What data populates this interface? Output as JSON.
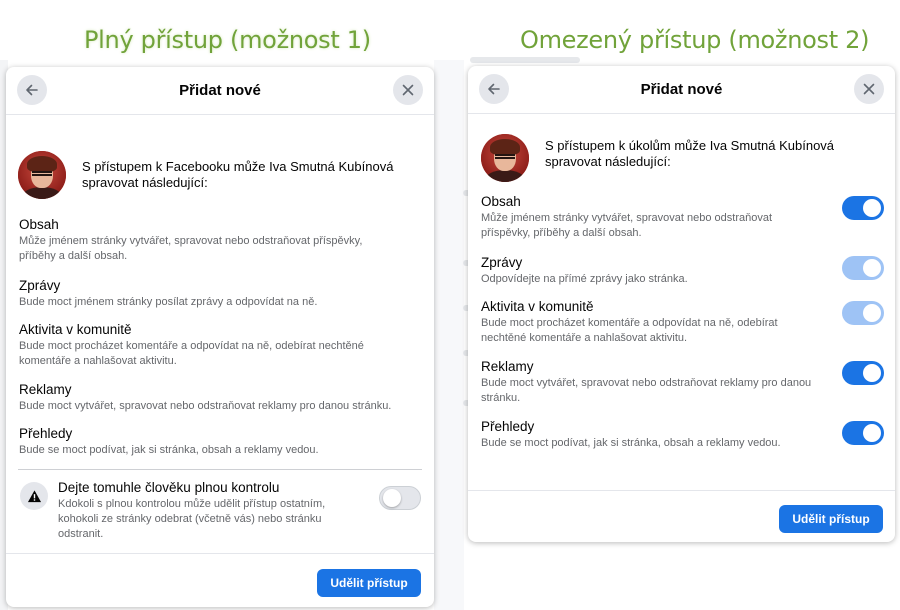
{
  "captions": {
    "left": "Plný přístup (možnost 1)",
    "right": "Omezený přístup (možnost 2)"
  },
  "colors": {
    "caption_green": "#71a33a",
    "primary_blue": "#1b74e4",
    "disabled_blue": "#9ec3f5",
    "secondary_text": "#65676b"
  },
  "icons": {
    "back": "arrow-left-icon",
    "close": "close-icon",
    "warning": "warning-triangle-icon"
  },
  "full_access": {
    "title": "Přidat nové",
    "intro": "S přístupem k Facebooku může Iva Smutná Kubínová spravovat následující:",
    "permissions": [
      {
        "title": "Obsah",
        "desc": "Může jménem stránky vytvářet, spravovat nebo odstraňovat příspěvky, příběhy a další obsah."
      },
      {
        "title": "Zprávy",
        "desc": "Bude moct jménem stránky posílat zprávy a odpovídat na ně."
      },
      {
        "title": "Aktivita v komunitě",
        "desc": "Bude moct procházet komentáře a odpovídat na ně, odebírat nechtěné komentáře a nahlašovat aktivitu."
      },
      {
        "title": "Reklamy",
        "desc": "Bude moct vytvářet, spravovat nebo odstraňovat reklamy pro danou stránku."
      },
      {
        "title": "Přehledy",
        "desc": "Bude se moct podívat, jak si stránka, obsah a reklamy vedou."
      }
    ],
    "full_control": {
      "title": "Dejte tomuhle člověku plnou kontrolu",
      "desc": "Kdokoli s plnou kontrolou může udělit přístup ostatním, kohokoli ze stránky odebrat (včetně vás) nebo stránku odstranit.",
      "enabled": false
    },
    "grant_button": "Udělit přístup"
  },
  "limited_access": {
    "title": "Přidat nové",
    "intro": "S přístupem k úkolům může Iva Smutná Kubínová spravovat následující:",
    "permissions": [
      {
        "title": "Obsah",
        "desc": "Může jménem stránky vytvářet, spravovat nebo odstraňovat příspěvky, příběhy a další obsah.",
        "state": "on"
      },
      {
        "title": "Zprávy",
        "desc": "Odpovídejte na přímé zprávy jako stránka.",
        "state": "on-disabled"
      },
      {
        "title": "Aktivita v komunitě",
        "desc": "Bude moct procházet komentáře a odpovídat na ně, odebírat nechtěné komentáře a nahlašovat aktivitu.",
        "state": "on-disabled"
      },
      {
        "title": "Reklamy",
        "desc": "Bude moct vytvářet, spravovat nebo odstraňovat reklamy pro danou stránku.",
        "state": "on"
      },
      {
        "title": "Přehledy",
        "desc": "Bude se moct podívat, jak si stránka, obsah a reklamy vedou.",
        "state": "on"
      }
    ],
    "grant_button": "Udělit přístup"
  }
}
